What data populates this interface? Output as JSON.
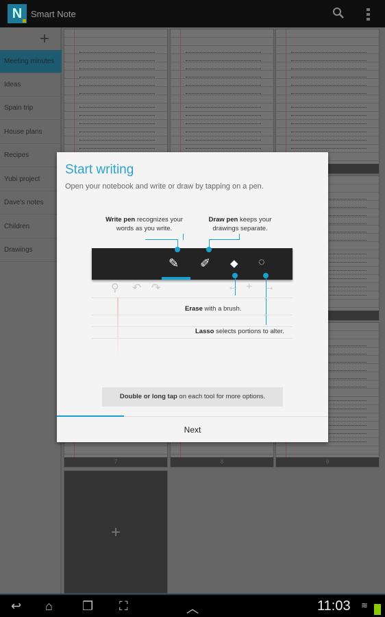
{
  "app": {
    "title": "Smart Note",
    "logo_text": "N"
  },
  "sidebar": {
    "add_label": "+",
    "items": [
      {
        "label": "Meeting minutes",
        "active": true
      },
      {
        "label": "Ideas"
      },
      {
        "label": "Spain trip"
      },
      {
        "label": "House plans"
      },
      {
        "label": "Recipes"
      },
      {
        "label": "Yubi project"
      },
      {
        "label": "Dave's notes"
      },
      {
        "label": "Children"
      },
      {
        "label": "Drawings"
      }
    ]
  },
  "pages": [
    {
      "number": ""
    },
    {
      "number": ""
    },
    {
      "number": ""
    },
    {
      "number": ""
    },
    {
      "number": ""
    },
    {
      "number": ""
    },
    {
      "number": "7"
    },
    {
      "number": "8"
    },
    {
      "number": "9"
    }
  ],
  "add_page": "+",
  "dialog": {
    "title": "Start writing",
    "subtitle": "Open your notebook and write or draw by tapping on a pen.",
    "write_pen": {
      "bold": "Write pen",
      "text": " recognizes your words as you write."
    },
    "draw_pen": {
      "bold": "Draw pen",
      "text": " keeps your drawings separate."
    },
    "erase": {
      "bold": "Erase",
      "text": " with a brush."
    },
    "lasso": {
      "bold": "Lasso",
      "text": " selects portions to alter."
    },
    "tip": {
      "bold": "Double or long tap",
      "text": " on each tool for more options."
    },
    "progress": 0.25,
    "next_label": "Next"
  },
  "status": {
    "time": "11:03"
  },
  "colors": {
    "accent": "#2aa3cf",
    "actionbar": "#0f0f0f",
    "battery": "#8acb00"
  }
}
